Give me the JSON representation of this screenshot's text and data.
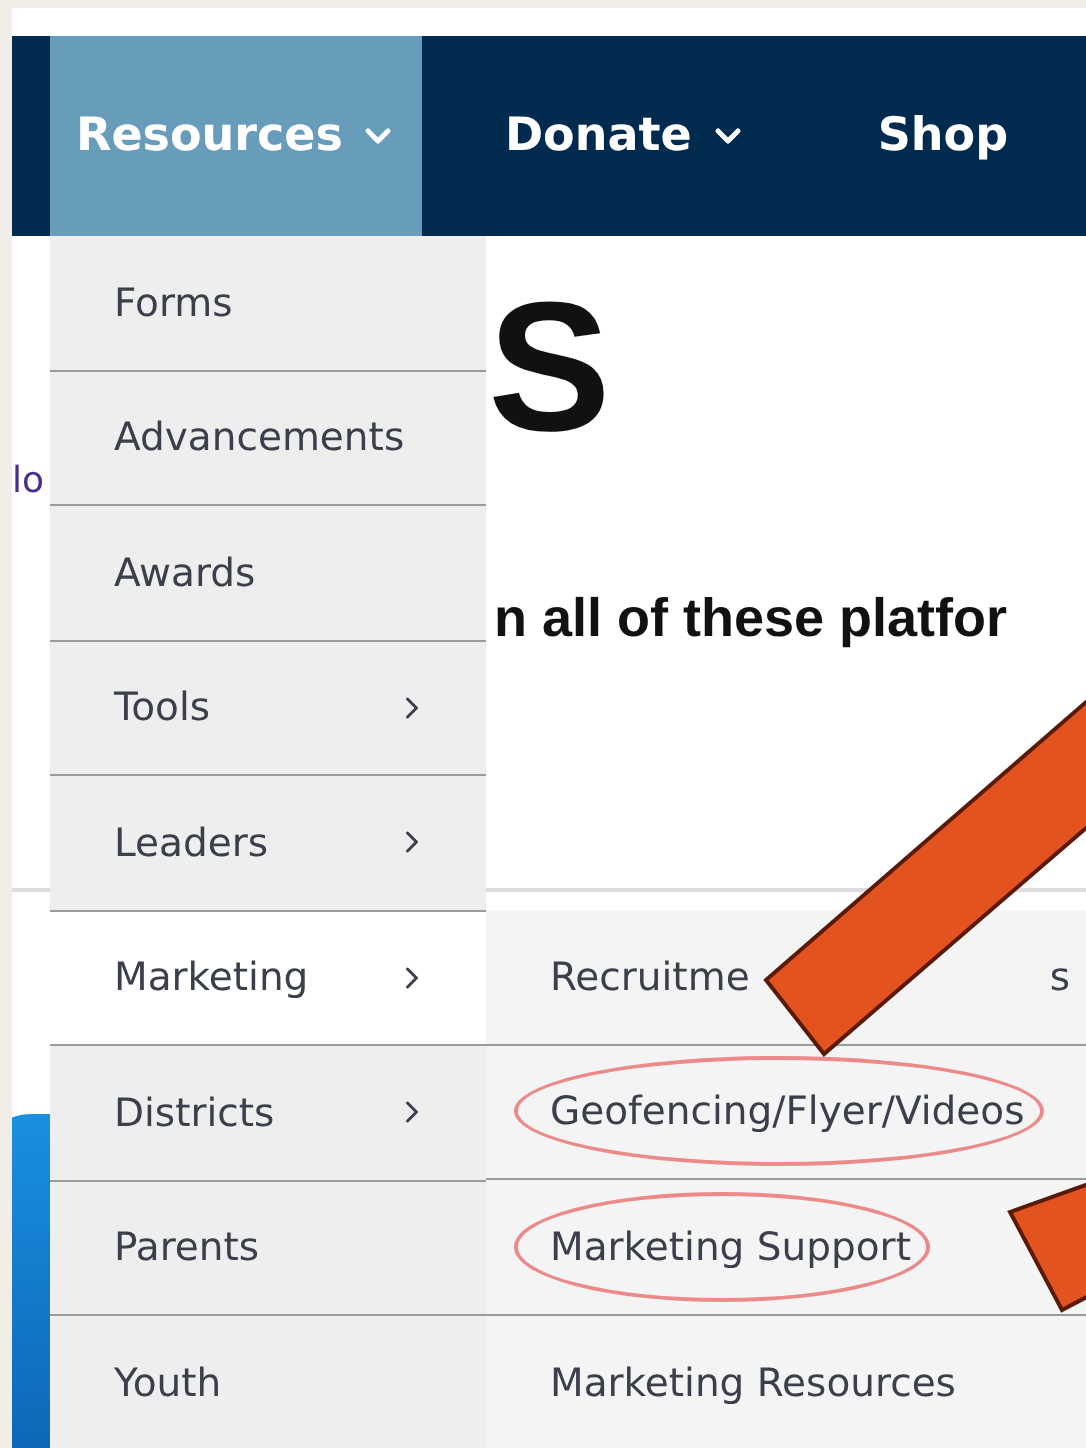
{
  "nav": {
    "items": [
      {
        "label": "Resources",
        "dropdown": true,
        "selected": true
      },
      {
        "label": "Donate",
        "dropdown": true,
        "selected": false
      },
      {
        "label": "Shop",
        "dropdown": false,
        "selected": false
      }
    ]
  },
  "background": {
    "heading_right": "S",
    "link": "lo",
    "subheading_right": "n all of these platfor"
  },
  "menu": {
    "items": [
      {
        "label": "Forms",
        "submenu": false,
        "selected": false
      },
      {
        "label": "Advancements",
        "submenu": false,
        "selected": false
      },
      {
        "label": "Awards",
        "submenu": false,
        "selected": false
      },
      {
        "label": "Tools",
        "submenu": true,
        "selected": false
      },
      {
        "label": "Leaders",
        "submenu": true,
        "selected": false
      },
      {
        "label": "Marketing",
        "submenu": true,
        "selected": true
      },
      {
        "label": "Districts",
        "submenu": true,
        "selected": false
      },
      {
        "label": "Parents",
        "submenu": false,
        "selected": false
      },
      {
        "label": "Youth",
        "submenu": false,
        "selected": false
      }
    ]
  },
  "submenu": {
    "items": [
      {
        "parts": [
          "Recruitme",
          "s"
        ],
        "circled": false
      },
      {
        "parts": [
          "Geofencing/Flyer/Videos"
        ],
        "circled": true
      },
      {
        "parts": [
          "Marketing Support"
        ],
        "circled": true
      },
      {
        "parts": [
          "Marketing Resources"
        ],
        "circled": false
      }
    ]
  }
}
